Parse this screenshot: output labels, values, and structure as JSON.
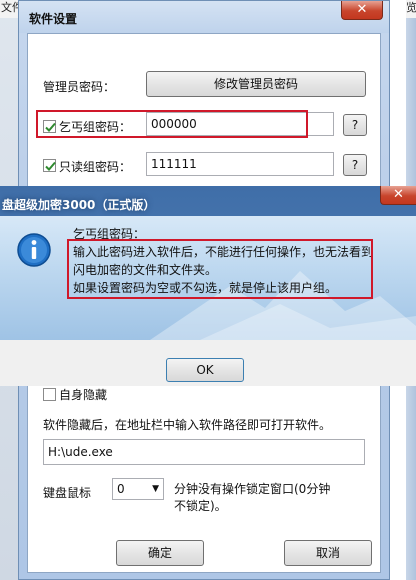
{
  "background_app": {
    "left_label": "文件",
    "right_label": "览"
  },
  "settings": {
    "title": "软件设置",
    "close_label": "✕",
    "admin_password_label": "管理员密码：",
    "modify_admin_button": "修改管理员密码",
    "beggar_group_label": "乞丐组密码：",
    "beggar_group_value": "000000",
    "readonly_group_label": "只读组密码：",
    "readonly_group_value": "111111",
    "help_label": "?",
    "self_hide_label": "自身隐藏",
    "hidden_hint": "软件隐藏后，在地址栏中输入软件路径即可打开软件。",
    "path_value": "H:\\ude.exe",
    "lock_label": "键盘鼠标",
    "lock_select_value": "0",
    "lock_desc_line1": "分钟没有操作锁定窗口(0分钟",
    "lock_desc_line2": "不锁定)。",
    "ok_button": "确定",
    "cancel_button": "取消"
  },
  "message": {
    "title": "盘超级加密3000（正式版）",
    "close_label": "✕",
    "heading": "乞丐组密码：",
    "line1": "输入此密码进入软件后，不能进行任何操作，也无法看到",
    "line2": "闪电加密的文件和文件夹。",
    "line3": "如果设置密码为空或不勾选，就是停止该用户组。",
    "ok_button": "OK"
  },
  "colors": {
    "highlight": "#d0182a",
    "check": "#2f8a2f",
    "info_icon": "#1f6fc4"
  }
}
